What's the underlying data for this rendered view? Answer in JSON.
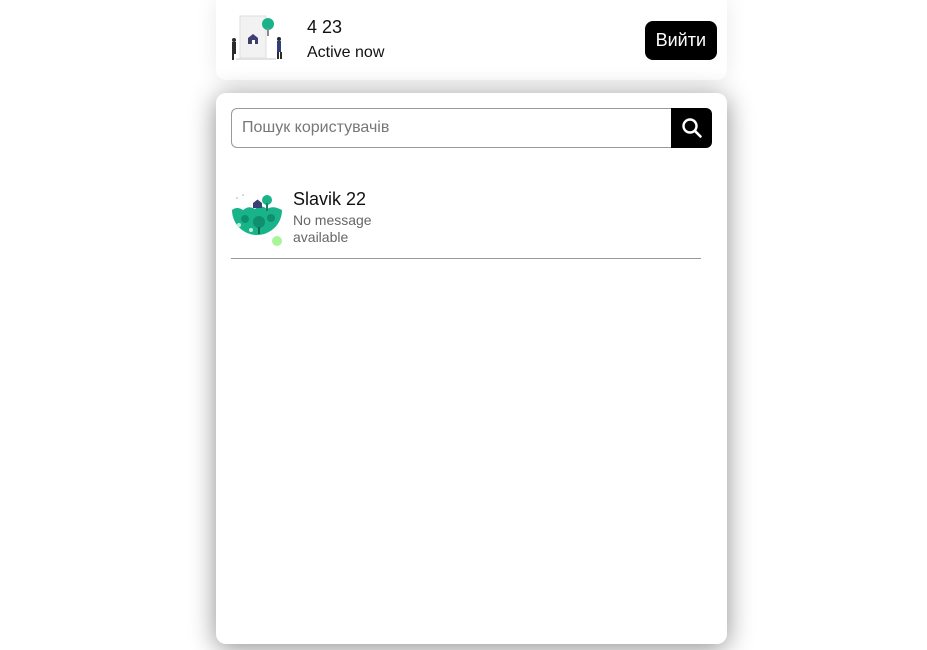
{
  "header": {
    "user_name": "4 23",
    "status": "Active now",
    "logout_label": "Вийти",
    "avatar_icon": "people-building-illustration-icon"
  },
  "search": {
    "placeholder": "Пошук користувачів",
    "value": "",
    "button_icon": "search-icon"
  },
  "users": [
    {
      "name": "Slavik 22",
      "message": "No message available",
      "online": true,
      "avatar_icon": "forest-illustration-icon"
    }
  ],
  "colors": {
    "accent": "#000000",
    "online": "#a8f59a",
    "illustration_green": "#19b38a"
  }
}
